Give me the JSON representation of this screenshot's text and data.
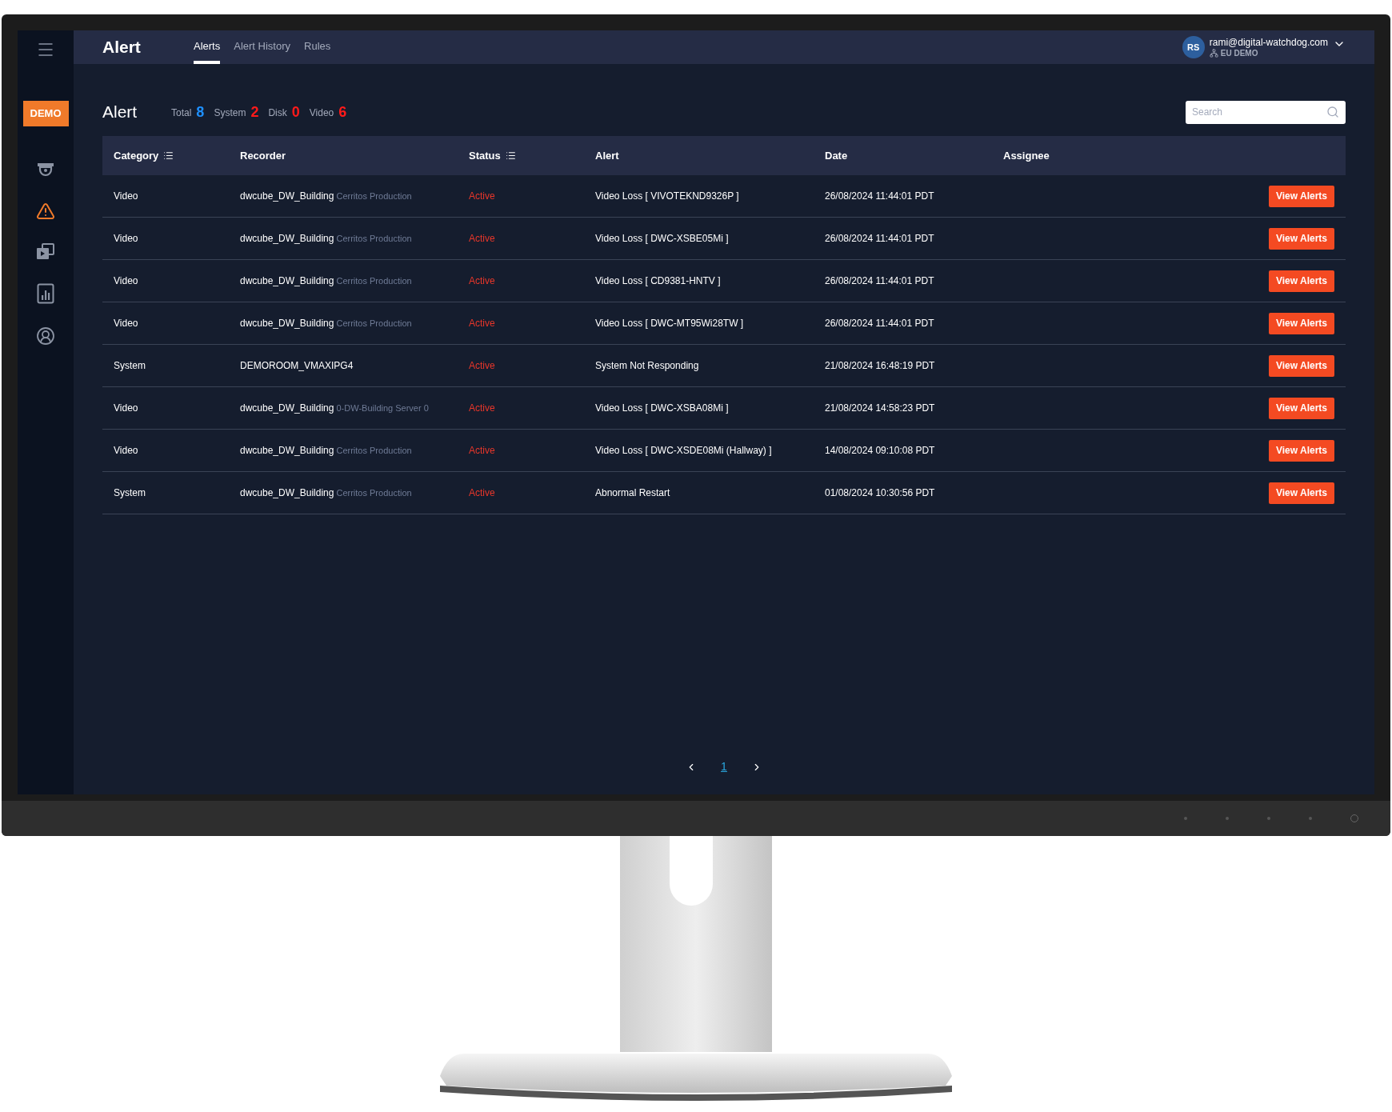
{
  "sidebar": {
    "badge": "DEMO",
    "items": [
      {
        "kind": "camera",
        "selected": false
      },
      {
        "kind": "alert",
        "selected": true
      },
      {
        "kind": "media",
        "selected": false
      },
      {
        "kind": "report",
        "selected": false
      },
      {
        "kind": "account",
        "selected": false
      }
    ]
  },
  "topbar": {
    "title": "Alert",
    "tabs": [
      {
        "label": "Alerts",
        "selected": true
      },
      {
        "label": "Alert History",
        "selected": false
      },
      {
        "label": "Rules",
        "selected": false
      }
    ],
    "user": {
      "initials": "RS",
      "email": "rami@digital-watchdog.com",
      "site": "EU DEMO"
    }
  },
  "page": {
    "title": "Alert",
    "counts": [
      {
        "label": "Total",
        "value": "8",
        "color": "#1e90ff"
      },
      {
        "label": "System",
        "value": "2",
        "color": "#ff1a1a"
      },
      {
        "label": "Disk",
        "value": "0",
        "color": "#ff1a1a"
      },
      {
        "label": "Video",
        "value": "6",
        "color": "#ff1a1a"
      }
    ],
    "search": {
      "placeholder": "Search"
    }
  },
  "table": {
    "columns": [
      {
        "label": "Category",
        "kind": "filterable"
      },
      {
        "label": "Recorder",
        "kind": "plain"
      },
      {
        "label": "Status",
        "kind": "filterable"
      },
      {
        "label": "Alert",
        "kind": "plain"
      },
      {
        "label": "Date",
        "kind": "plain"
      },
      {
        "label": "Assignee",
        "kind": "plain"
      }
    ],
    "rows": [
      {
        "category": "Video",
        "recorder": "dwcube_DW_Building",
        "recorder_detail": "Cerritos Production",
        "status": "Active",
        "alert": "Video Loss [ VIVOTEKND9326P ]",
        "date": "26/08/2024 11:44:01 PDT",
        "action": "View Alerts"
      },
      {
        "category": "Video",
        "recorder": "dwcube_DW_Building",
        "recorder_detail": "Cerritos Production",
        "status": "Active",
        "alert": "Video Loss [ DWC-XSBE05Mi ]",
        "date": "26/08/2024 11:44:01 PDT",
        "action": "View Alerts"
      },
      {
        "category": "Video",
        "recorder": "dwcube_DW_Building",
        "recorder_detail": "Cerritos Production",
        "status": "Active",
        "alert": "Video Loss [ CD9381-HNTV ]",
        "date": "26/08/2024 11:44:01 PDT",
        "action": "View Alerts"
      },
      {
        "category": "Video",
        "recorder": "dwcube_DW_Building",
        "recorder_detail": "Cerritos Production",
        "status": "Active",
        "alert": "Video Loss [ DWC-MT95Wi28TW ]",
        "date": "26/08/2024 11:44:01 PDT",
        "action": "View Alerts"
      },
      {
        "category": "System",
        "recorder": "DEMOROOM_VMAXIPG4",
        "status": "Active",
        "alert": "System Not Responding",
        "date": "21/08/2024 16:48:19 PDT",
        "action": "View Alerts"
      },
      {
        "category": "Video",
        "recorder": "dwcube_DW_Building",
        "recorder_detail": "0-DW-Building Server 0",
        "status": "Active",
        "alert": "Video Loss [ DWC-XSBA08Mi ]",
        "date": "21/08/2024 14:58:23 PDT",
        "action": "View Alerts"
      },
      {
        "category": "Video",
        "recorder": "dwcube_DW_Building",
        "recorder_detail": "Cerritos Production",
        "status": "Active",
        "alert": "Video Loss [ DWC-XSDE08Mi (Hallway) ]",
        "date": "14/08/2024 09:10:08 PDT",
        "action": "View Alerts"
      },
      {
        "category": "System",
        "recorder": "dwcube_DW_Building",
        "recorder_detail": "Cerritos Production",
        "status": "Active",
        "alert": "Abnormal Restart",
        "date": "01/08/2024 10:30:56 PDT",
        "action": "View Alerts"
      }
    ]
  },
  "pagination": {
    "pages": [
      {
        "label": "1",
        "selected": true
      }
    ]
  }
}
